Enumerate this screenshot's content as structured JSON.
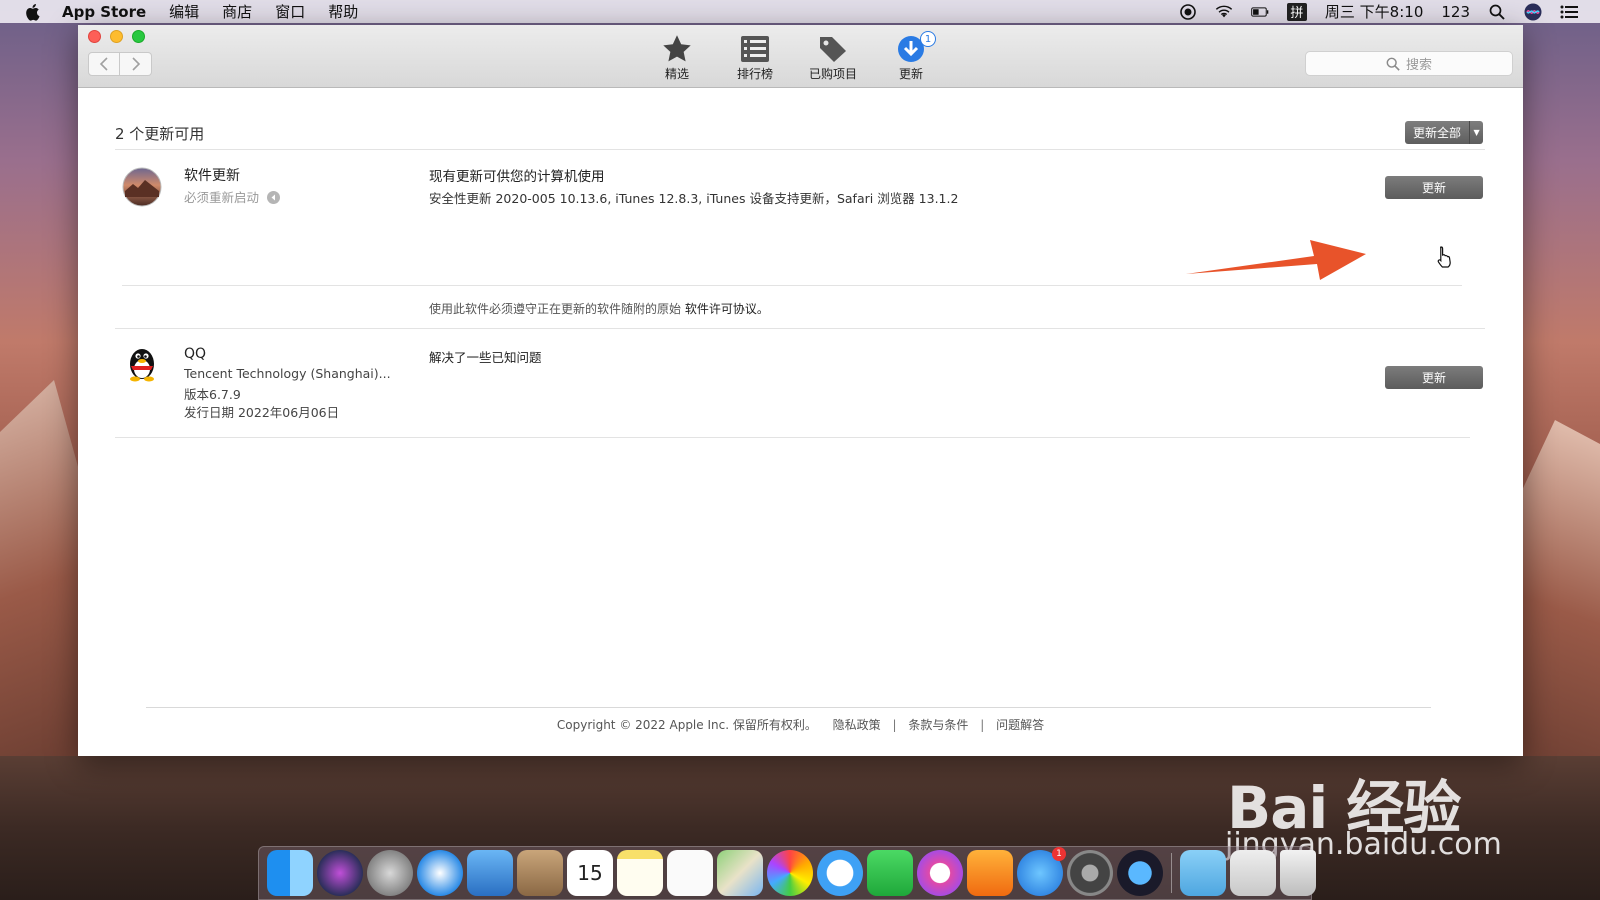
{
  "menubar": {
    "app_name": "App Store",
    "items": [
      "编辑",
      "商店",
      "窗口",
      "帮助"
    ],
    "clock": "周三 下午8:10",
    "user": "123",
    "ime": "拼"
  },
  "toolbar": {
    "tabs": [
      {
        "label": "精选",
        "icon": "star-icon"
      },
      {
        "label": "排行榜",
        "icon": "list-icon"
      },
      {
        "label": "已购项目",
        "icon": "tag-icon"
      },
      {
        "label": "更新",
        "icon": "updates-icon",
        "badge": "1"
      }
    ],
    "search_placeholder": "搜索"
  },
  "main": {
    "updates_count": "2 个更新可用",
    "update_all_label": "更新全部",
    "apps": [
      {
        "name": "软件更新",
        "sub": "必须重新启动",
        "desc_title": "现有更新可供您的计算机使用",
        "desc_body": "安全性更新 2020-005 10.13.6, iTunes 12.8.3, iTunes 设备支持更新，Safari 浏览器 13.1.2",
        "button": "更新"
      },
      {
        "name": "QQ",
        "developer": "Tencent Technology (Shanghai)...",
        "version": "版本6.7.9",
        "date": "发行日期 2022年06月06日",
        "desc_title": "解决了一些已知问题",
        "button": "更新"
      }
    ],
    "license_prefix": "使用此软件必须遵守正在更新的软件随附的原始 ",
    "license_link": "软件许可协议。"
  },
  "footer": {
    "copyright": "Copyright © 2022 Apple Inc. 保留所有权利。",
    "links": [
      "隐私政策",
      "条款与条件",
      "问题解答"
    ]
  },
  "dock": {
    "apps": [
      "finder-icon",
      "siri-icon",
      "launchpad-icon",
      "safari-icon",
      "mail-icon",
      "contacts-icon",
      "calendar-icon",
      "notes-icon",
      "reminders-icon",
      "maps-icon",
      "photos-icon",
      "messages-icon",
      "facetime-icon",
      "itunes-icon",
      "ibooks-icon",
      "appstore-icon",
      "system-preferences-icon",
      "quicktime-icon",
      "downloads-folder-icon",
      "documents-icon",
      "trash-icon"
    ],
    "calendar_day": "15",
    "appstore_badge": "1"
  },
  "watermark": {
    "brand": "Bai 经验",
    "url": "jingyan.baidu.com"
  },
  "colors": {
    "accent": "#2a7be4",
    "arrow": "#e8532a"
  }
}
